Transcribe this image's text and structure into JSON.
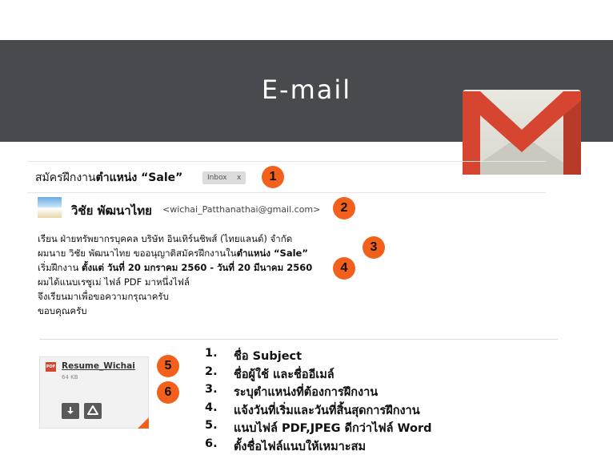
{
  "slide": {
    "title": "E-mail"
  },
  "email": {
    "subject_prefix": "สมัครฝึกงาน",
    "subject_bold": "ตำแหน่ง “Sale”",
    "inbox_label": "Inbox",
    "inbox_close": "x",
    "sender_name": "วิชัย พัฒนาไทย",
    "sender_email": "<wichai_Patthanathai@gmail.com>",
    "body": {
      "line1": "เรียน ฝ่ายทรัพยากรบุคคล บริษัท อินเทิร์นชิพส์ (ไทยแลนด์) จำกัด",
      "line2_prefix": "ผมนาย วิชัย พัฒนาไทย ขออนุญาติสมัครฝึกงานใน",
      "line2_bold": "ตำแหน่ง “Sale”",
      "line3_prefix": "เริ่มฝึกงาน ",
      "line3_bold": "ตั้งแต่ วันที่ 20 มกราคม 2560 - วันที่ 20 มีนาคม 2560",
      "line4": "ผมได้แนบเรซูเม่ ไฟล์ PDF มาหนึ่งไฟล์",
      "line5": "จึงเรียนมาเพื่อขอความกรุณาครับ",
      "line6": "ขอบคุณครับ"
    },
    "attachment": {
      "file_type": "PDF",
      "name": "Resume_Wichai",
      "size": "64 KB"
    }
  },
  "markers": [
    "1",
    "2",
    "3",
    "4",
    "5",
    "6"
  ],
  "steps": [
    {
      "num": "1.",
      "text": "ชื่อ Subject"
    },
    {
      "num": "2.",
      "text": "ชื่อผู้ใช้ และชื่ออีเมล์"
    },
    {
      "num": "3.",
      "text": "ระบุตำแหน่งที่ต้องการฝึกงาน"
    },
    {
      "num": "4.",
      "text": "แจ้งวันที่เริ่มและวันที่สิ้นสุดการฝึกงาน"
    },
    {
      "num": "5.",
      "text": "แนบไฟล์ PDF,JPEG ดีกว่าไฟล์ Word"
    },
    {
      "num": "6.",
      "text": "ตั้งชื่อไฟล์แนบให้เหมาะสม"
    }
  ],
  "colors": {
    "banner": "#474a4f",
    "marker": "#f2601c",
    "gmail_red": "#d6452f"
  },
  "icons": [
    "gmail-logo-icon",
    "pdf-icon",
    "download-icon",
    "google-drive-icon"
  ]
}
